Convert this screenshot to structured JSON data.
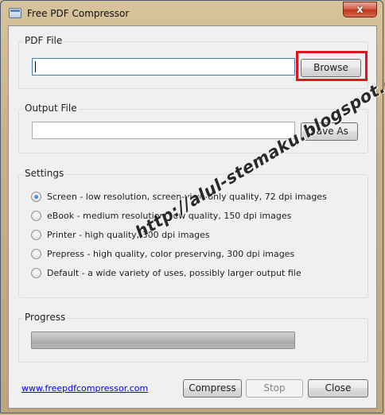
{
  "window": {
    "title": "Free PDF Compressor",
    "close_icon": "close-icon",
    "close_glyph": "x"
  },
  "pdf_file": {
    "group_label": "PDF File",
    "value": "",
    "browse_label": "Browse"
  },
  "output_file": {
    "group_label": "Output File",
    "value": "",
    "save_as_label": "Save As"
  },
  "settings": {
    "group_label": "Settings",
    "selected_index": 0,
    "options": [
      "Screen - low resolution, screen-view-only quality, 72 dpi images",
      "eBook - medium resolution, low quality, 150 dpi images",
      "Printer - high quality, 300 dpi images",
      "Prepress - high quality, color preserving, 300 dpi images",
      "Default - a wide variety of uses, possibly larger output file"
    ]
  },
  "progress": {
    "group_label": "Progress",
    "percent": 0
  },
  "footer": {
    "link_text": "www.freepdfcompressor.com",
    "compress_label": "Compress",
    "stop_label": "Stop",
    "close_label": "Close"
  },
  "watermark": {
    "text": "http://alul-stemaku.blogspot.com/"
  },
  "colors": {
    "highlight": "#e0151f",
    "link": "#0000ee",
    "window_frame": "#c7b18a"
  }
}
